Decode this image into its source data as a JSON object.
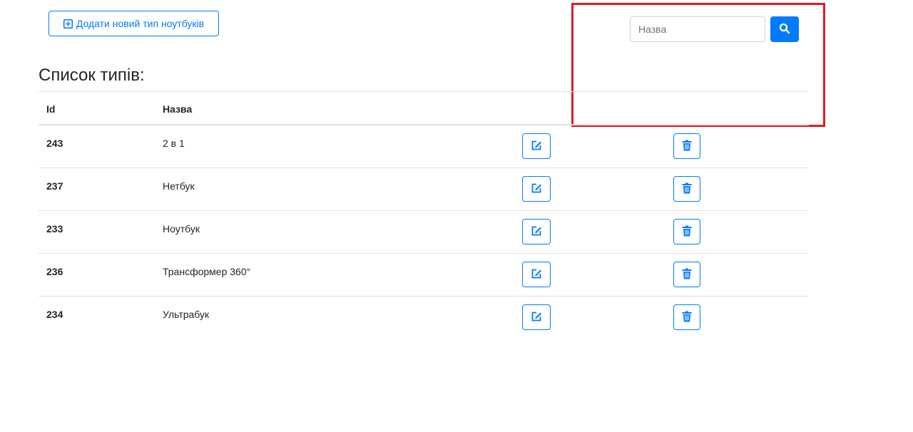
{
  "toolbar": {
    "add_label": "Додати новий тип ноутбуків"
  },
  "search": {
    "placeholder": "Назва"
  },
  "page_title": "Список типів:",
  "table": {
    "columns": [
      "Id",
      "Назва"
    ],
    "rows": [
      {
        "id": "243",
        "name": "2 в 1"
      },
      {
        "id": "237",
        "name": "Нетбук"
      },
      {
        "id": "233",
        "name": "Ноутбук"
      },
      {
        "id": "236",
        "name": "Трансформер 360°"
      },
      {
        "id": "234",
        "name": "Ультрабук"
      }
    ]
  },
  "icons": {
    "add": "plus-square-icon",
    "search": "search-icon",
    "edit": "edit-icon",
    "delete": "trash-icon"
  },
  "colors": {
    "primary": "#007bff",
    "highlight": "#e31b23",
    "border": "#dee2e6"
  }
}
